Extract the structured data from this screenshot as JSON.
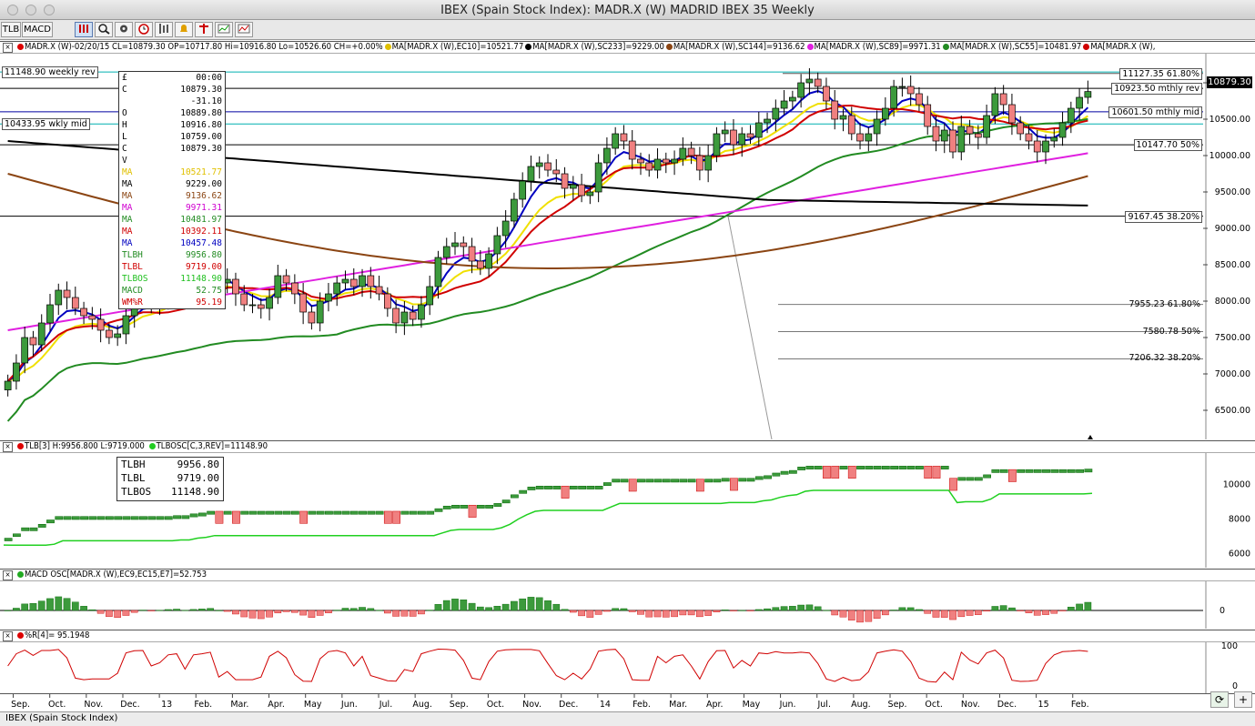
{
  "window": {
    "title": "IBEX (Spain Stock Index): MADR.X (W) MADRID IBEX 35 Weekly"
  },
  "toolbar": {
    "tlb_label": "TLB",
    "macd_label": "MACD"
  },
  "price_panel": {
    "header": "MADR.X (W)-02/20/15 CL=10879.30 OP=10717.80 Hi=10916.80 Lo=10526.60 CH=+0.00%",
    "ma_legend": [
      {
        "text": "MA[MADR.X (W),EC10]=10521.77",
        "color": "#e0c000"
      },
      {
        "text": "MA[MADR.X (W),SC233]=9229.00",
        "color": "#000000"
      },
      {
        "text": "MA[MADR.X (W),SC144]=9136.62",
        "color": "#8b4513"
      },
      {
        "text": "MA[MADR.X (W),SC89]=9971.31",
        "color": "#e020e0"
      },
      {
        "text": "MA[MADR.X (W),SC55]=10481.97",
        "color": "#228b22"
      },
      {
        "text": "MA[MADR.X (W),",
        "color": "#d00000"
      }
    ],
    "last_price": "10879.30",
    "y_ticks": [
      "11000.00",
      "10500.00",
      "10000.00",
      "9500.00",
      "9000.00",
      "8500.00",
      "8000.00",
      "7500.00",
      "7000.00",
      "6500.00"
    ],
    "levels": [
      {
        "label": "11148.90 weekly rev",
        "side": "left"
      },
      {
        "label": "10433.95 wkly mid",
        "side": "left"
      },
      {
        "label": "11127.35 61.80%",
        "side": "right"
      },
      {
        "label": "10923.50 mthly rev",
        "side": "right"
      },
      {
        "label": "10601.50 mthly mid",
        "side": "right"
      },
      {
        "label": "10147.70 50%",
        "side": "right"
      },
      {
        "label": "9167.45 38.20%",
        "side": "right"
      },
      {
        "label": "7955.23 61.80%",
        "side": "right"
      },
      {
        "label": "7580.78 50%",
        "side": "right"
      },
      {
        "label": "7206.32 38.20%",
        "side": "right"
      }
    ],
    "databox": [
      {
        "k": "£",
        "v": "00:00",
        "c": "#000"
      },
      {
        "k": "C",
        "v": "10879.30",
        "c": "#000"
      },
      {
        "k": "",
        "v": "-31.10",
        "c": "#000"
      },
      {
        "k": "O",
        "v": "10889.80",
        "c": "#000"
      },
      {
        "k": "H",
        "v": "10916.80",
        "c": "#000"
      },
      {
        "k": "L",
        "v": "10759.00",
        "c": "#000"
      },
      {
        "k": "C",
        "v": "10879.30",
        "c": "#000"
      },
      {
        "k": "V",
        "v": "",
        "c": "#000"
      },
      {
        "k": "MA",
        "v": "10521.77",
        "c": "#e0c000"
      },
      {
        "k": "MA",
        "v": "9229.00",
        "c": "#000"
      },
      {
        "k": "MA",
        "v": "9136.62",
        "c": "#8b4513"
      },
      {
        "k": "MA",
        "v": "9971.31",
        "c": "#d000d0"
      },
      {
        "k": "MA",
        "v": "10481.97",
        "c": "#228b22"
      },
      {
        "k": "MA",
        "v": "10392.11",
        "c": "#d00000"
      },
      {
        "k": "MA",
        "v": "10457.48",
        "c": "#0000c0"
      },
      {
        "k": "TLBH",
        "v": "9956.80",
        "c": "#228b22"
      },
      {
        "k": "TLBL",
        "v": "9719.00",
        "c": "#d00000"
      },
      {
        "k": "TLBOS",
        "v": "11148.90",
        "c": "#20c020"
      },
      {
        "k": "MACD",
        "v": "52.75",
        "c": "#228b22"
      },
      {
        "k": "WM%R",
        "v": "95.19",
        "c": "#d00000"
      }
    ]
  },
  "tlb_panel": {
    "header": "TLB[3] H:9956.800 L:9719.000",
    "header2": "TLBOSC[C,3,REV]=11148.90",
    "box": [
      {
        "k": "TLBH",
        "v": "9956.80"
      },
      {
        "k": "TLBL",
        "v": "9719.00"
      },
      {
        "k": "TLBOS",
        "v": "11148.90"
      }
    ],
    "y_ticks": [
      "10000",
      "8000",
      "6000"
    ]
  },
  "macd_panel": {
    "header": "MACD OSC[MADR.X (W),EC9,EC15,E7]=52.753",
    "y_ticks": [
      "0"
    ]
  },
  "wr_panel": {
    "header": "%R[4]= 95.1948",
    "y_ticks": [
      "100",
      "0"
    ]
  },
  "x_axis": {
    "labels": [
      "Sep.",
      "Oct.",
      "Nov.",
      "Dec.",
      "13",
      "Feb.",
      "Mar.",
      "Apr.",
      "May",
      "Jun.",
      "Jul.",
      "Aug.",
      "Sep.",
      "Oct.",
      "Nov.",
      "Dec.",
      "14",
      "Feb.",
      "Mar.",
      "Apr.",
      "May",
      "Jun.",
      "Jul.",
      "Aug.",
      "Sep.",
      "Oct.",
      "Nov.",
      "Dec.",
      "15",
      "Feb."
    ]
  },
  "status": {
    "text": "IBEX (Spain Stock Index)"
  },
  "chart_data": {
    "type": "candlestick",
    "symbol": "MADR.X (W)",
    "title": "IBEX (Spain Stock Index): MADR.X (W) MADRID IBEX 35 Weekly",
    "ylim": [
      6100,
      11400
    ],
    "weekly_close": [
      6900,
      7150,
      7500,
      7400,
      7700,
      7950,
      8150,
      8050,
      7900,
      7800,
      7750,
      7600,
      7500,
      7550,
      7800,
      8000,
      8100,
      7950,
      8050,
      8150,
      8200,
      8100,
      8300,
      8350,
      8450,
      8250,
      8300,
      8100,
      7950,
      7950,
      7900,
      8050,
      8350,
      8250,
      8100,
      7850,
      7700,
      8000,
      8100,
      8250,
      8300,
      8200,
      8350,
      8200,
      8100,
      7900,
      7700,
      7850,
      7750,
      7950,
      8200,
      8600,
      8750,
      8800,
      8750,
      8550,
      8450,
      8650,
      8900,
      9100,
      9400,
      9650,
      9850,
      9900,
      9800,
      9750,
      9550,
      9600,
      9450,
      9500,
      9900,
      10100,
      10300,
      10200,
      9950,
      9900,
      9800,
      9950,
      9900,
      9950,
      10100,
      10000,
      9800,
      10000,
      10300,
      10350,
      10150,
      10300,
      10250,
      10450,
      10500,
      10650,
      10750,
      10800,
      11000,
      11050,
      10950,
      10750,
      10500,
      10550,
      10300,
      10200,
      10300,
      10500,
      10650,
      10950,
      10950,
      10850,
      10700,
      10400,
      10200,
      10350,
      10050,
      10400,
      10300,
      10250,
      10550,
      10850,
      10700,
      10450,
      10300,
      10200,
      10050,
      10200,
      10250,
      10450,
      10650,
      10800,
      10880
    ],
    "ma_series": [
      {
        "name": "EC10",
        "color": "#e0c000",
        "last": 10521.77
      },
      {
        "name": "SC233",
        "color": "#000000",
        "last": 9229.0
      },
      {
        "name": "SC144",
        "color": "#8b4513",
        "last": 9136.62
      },
      {
        "name": "SC89",
        "color": "#e020e0",
        "last": 9971.31
      },
      {
        "name": "SC55",
        "color": "#228b22",
        "last": 10481.97
      },
      {
        "color": "#d00000",
        "last": 10392.11
      },
      {
        "color": "#0000c0",
        "last": 10457.48
      }
    ]
  }
}
